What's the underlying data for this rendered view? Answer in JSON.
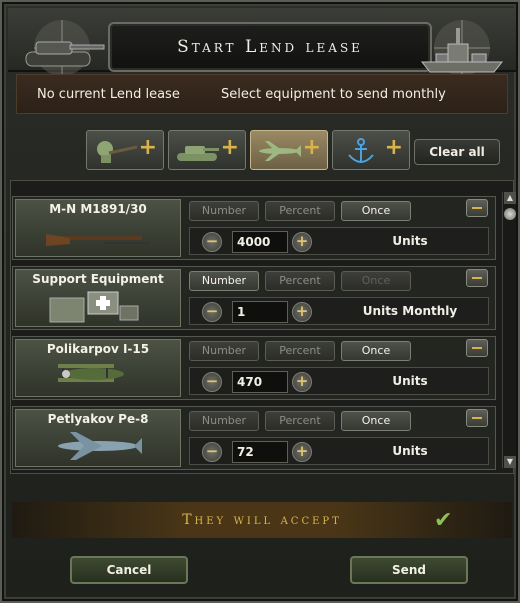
{
  "header": {
    "title": "Start Lend lease"
  },
  "info": {
    "current": "No current Lend lease",
    "hint": "Select equipment to send monthly"
  },
  "filters": [
    {
      "icon": "infantry-icon",
      "active": false
    },
    {
      "icon": "tank-icon",
      "active": false
    },
    {
      "icon": "plane-icon",
      "active": true
    },
    {
      "icon": "anchor-icon",
      "active": false
    }
  ],
  "clear_all_label": "Clear all",
  "modes": {
    "number": "Number",
    "percent": "Percent",
    "once": "Once"
  },
  "rows": [
    {
      "name": "M-N M1891/30",
      "qty": "4000",
      "units": "Units",
      "selected_mode": "once",
      "icon": "rifle-icon"
    },
    {
      "name": "Support Equipment",
      "qty": "1",
      "units": "Units Monthly",
      "selected_mode": "number",
      "icon": "support-equipment-icon"
    },
    {
      "name": "Polikarpov I-15",
      "qty": "470",
      "units": "Units",
      "selected_mode": "once",
      "icon": "biplane-icon"
    },
    {
      "name": "Petlyakov Pe-8",
      "qty": "72",
      "units": "Units",
      "selected_mode": "once",
      "icon": "bomber-icon"
    }
  ],
  "accept": {
    "text": "They will accept",
    "status_icon": "checkmark-icon",
    "color": "#d9b54a"
  },
  "footer": {
    "cancel_label": "Cancel",
    "send_label": "Send"
  }
}
